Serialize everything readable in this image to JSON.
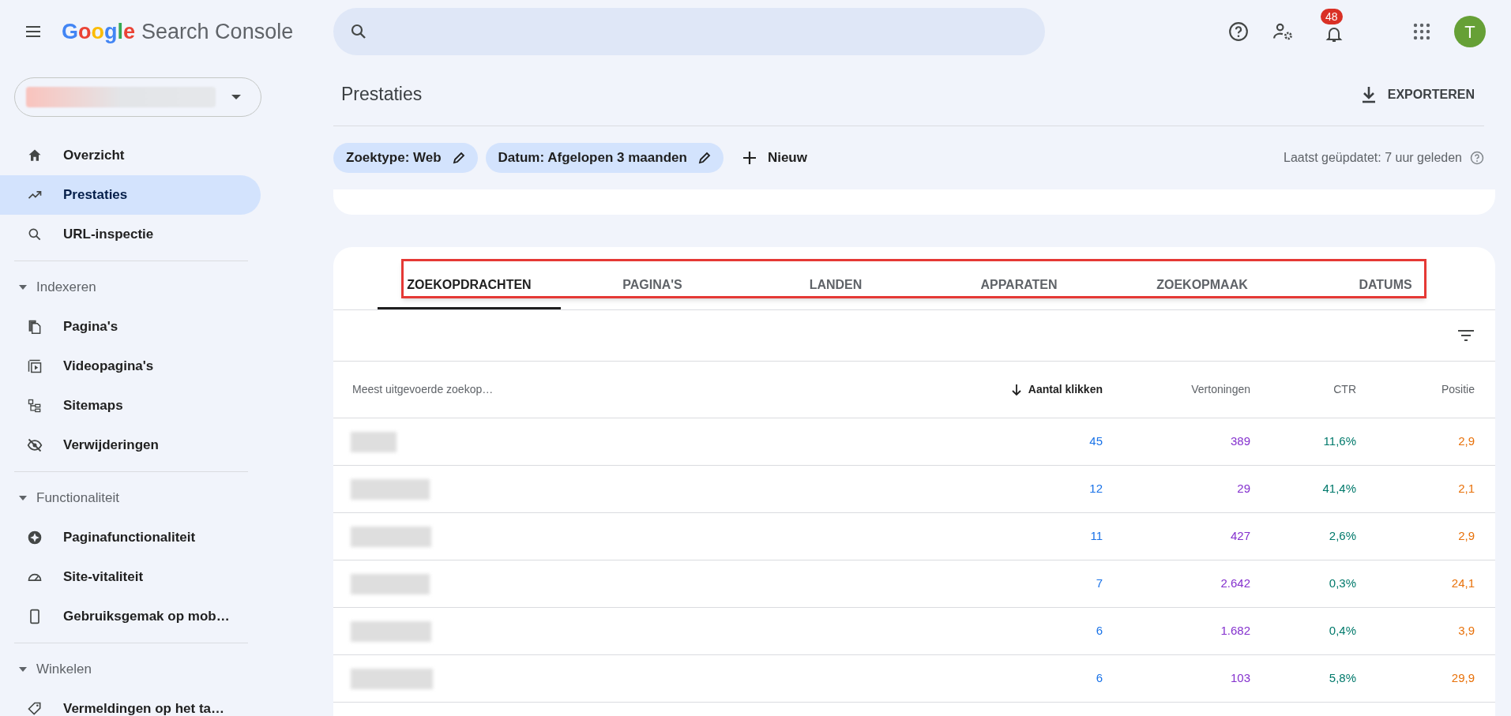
{
  "header": {
    "logo": {
      "brand": "Google",
      "product": "Search Console"
    },
    "notification_count": "48",
    "avatar_letter": "T"
  },
  "sidebar": {
    "nav": [
      {
        "label": "Overzicht",
        "selected": false
      },
      {
        "label": "Prestaties",
        "selected": true
      },
      {
        "label": "URL-inspectie",
        "selected": false
      }
    ],
    "sections": [
      {
        "title": "Indexeren",
        "expanded": true,
        "items": [
          {
            "label": "Pagina's",
            "selected": false
          },
          {
            "label": "Videopagina's",
            "selected": false
          },
          {
            "label": "Sitemaps",
            "selected": false
          },
          {
            "label": "Verwijderingen",
            "selected": false
          }
        ]
      },
      {
        "title": "Functionaliteit",
        "expanded": true,
        "items": [
          {
            "label": "Paginafunctionaliteit",
            "selected": false
          },
          {
            "label": "Site-vitaliteit",
            "selected": false
          },
          {
            "label": "Gebruiksgemak op mob…",
            "selected": false
          }
        ]
      },
      {
        "title": "Winkelen",
        "expanded": true,
        "items": [
          {
            "label": "Vermeldingen op het ta…",
            "selected": false
          }
        ]
      }
    ]
  },
  "page": {
    "title": "Prestaties",
    "export_label": "EXPORTEREN",
    "filters": [
      {
        "label": "Zoektype: Web"
      },
      {
        "label": "Datum: Afgelopen 3 maanden"
      }
    ],
    "new_filter_label": "Nieuw",
    "last_updated": "Laatst geüpdatet: 7 uur geleden"
  },
  "tabs": [
    {
      "label": "ZOEKOPDRACHTEN",
      "selected": true
    },
    {
      "label": "PAGINA'S",
      "selected": false
    },
    {
      "label": "LANDEN",
      "selected": false
    },
    {
      "label": "APPARATEN",
      "selected": false
    },
    {
      "label": "ZOEKOPMAAK",
      "selected": false
    },
    {
      "label": "DATUMS",
      "selected": false
    }
  ],
  "table": {
    "columns": [
      {
        "label": "Meest uitgevoerde zoekop…",
        "sorted": false
      },
      {
        "label": "Aantal klikken",
        "sorted": true,
        "color": "#1a73e8"
      },
      {
        "label": "Vertoningen",
        "sorted": false,
        "color": "#8430ce"
      },
      {
        "label": "CTR",
        "sorted": false,
        "color": "#00796b"
      },
      {
        "label": "Positie",
        "sorted": false,
        "color": "#e8710a"
      }
    ],
    "rows": [
      [
        "",
        "45",
        "389",
        "11,6%",
        "2,9"
      ],
      [
        "",
        "12",
        "29",
        "41,4%",
        "2,1"
      ],
      [
        "",
        "11",
        "427",
        "2,6%",
        "2,9"
      ],
      [
        "",
        "7",
        "2.642",
        "0,3%",
        "24,1"
      ],
      [
        "",
        "6",
        "1.682",
        "0,4%",
        "3,9"
      ],
      [
        "",
        "6",
        "103",
        "5,8%",
        "29,9"
      ]
    ]
  }
}
